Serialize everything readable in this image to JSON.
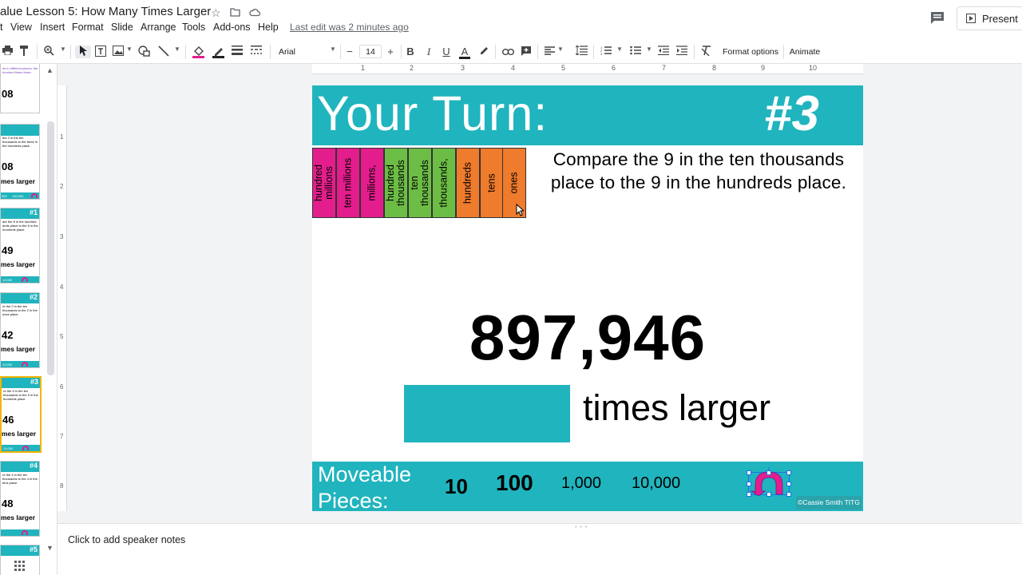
{
  "app": {
    "doc_title": "alue Lesson 5: How Many Times Larger",
    "last_edit": "Last edit was 2 minutes ago",
    "present_label": "Present"
  },
  "menu": [
    "t",
    "View",
    "Insert",
    "Format",
    "Slide",
    "Arrange",
    "Tools",
    "Add-ons",
    "Help"
  ],
  "toolbar": {
    "font_name": "Arial",
    "font_size": "14",
    "format_options": "Format options",
    "animate": "Animate",
    "bold": "B",
    "italic": "I",
    "underline": "U",
    "text_color": "A",
    "minus": "−",
    "plus": "+"
  },
  "ruler": {
    "h_numbers": [
      "1",
      "2",
      "3",
      "4",
      "5",
      "6",
      "7",
      "8",
      "9",
      "10"
    ],
    "v_numbers": [
      "1",
      "2",
      "3",
      "4",
      "5",
      "6",
      "7",
      "8"
    ]
  },
  "filmstrip": {
    "thumbs": [
      {
        "number": "",
        "text": "ds in different places. the hundred times three.",
        "big": "08",
        "label": ""
      },
      {
        "number": "",
        "text": "the 3 in the ten thousands to the three in the hundreds place.",
        "big": "08",
        "label": "mes larger"
      },
      {
        "number": "#1",
        "text": "are the 6 in the hundred ands place to the 6 in the hundreds place.",
        "big": "49",
        "label": "mes larger"
      },
      {
        "number": "#2",
        "text": "re the 2 in the ten thousands to the 2 in the ones place.",
        "big": "42",
        "label": "mes larger"
      },
      {
        "number": "#3",
        "text": "re the 9 in the ten thousands to the 9 in the hundreds place.",
        "big": "46",
        "label": "mes larger"
      },
      {
        "number": "#4",
        "text": "re the 4 in the ten thousands to the 4 in the tens place.",
        "big": "48",
        "label": "mes larger"
      },
      {
        "number": "#5",
        "text": "",
        "big": "",
        "label": ""
      }
    ],
    "thumb1_small_1": "000",
    "thumb1_small_2": "100,000",
    "thumb_small": "10,000"
  },
  "slide": {
    "header_title": "Your Turn:",
    "header_number": "#3",
    "place_value_columns": [
      {
        "label": "hundred millions",
        "color": "#e31e8c"
      },
      {
        "label": "ten millions",
        "color": "#e31e8c"
      },
      {
        "label": "millions,",
        "color": "#e31e8c"
      },
      {
        "label": "hundred thousands",
        "color": "#6cbd45"
      },
      {
        "label": "ten thousands",
        "color": "#6cbd45"
      },
      {
        "label": "thousands,",
        "color": "#6cbd45"
      },
      {
        "label": "hundreds",
        "color": "#ef7b2c"
      },
      {
        "label": "tens",
        "color": "#ef7b2c"
      },
      {
        "label": "ones",
        "color": "#ef7b2c"
      }
    ],
    "instructions": "Compare the 9 in the ten thousands place to the 9 in the hundreds place.",
    "big_number": "897,946",
    "times_larger": "times larger",
    "footer_label": "Moveable Pieces:",
    "pieces": [
      "10",
      "100",
      "1,000",
      "10,000"
    ],
    "credit": "©Cassie Smith TITG"
  },
  "notes": {
    "placeholder": "Click to add speaker notes"
  },
  "colors": {
    "teal": "#20b4be",
    "pink": "#e31e8c",
    "green": "#6cbd45",
    "orange": "#ef7b2c"
  }
}
